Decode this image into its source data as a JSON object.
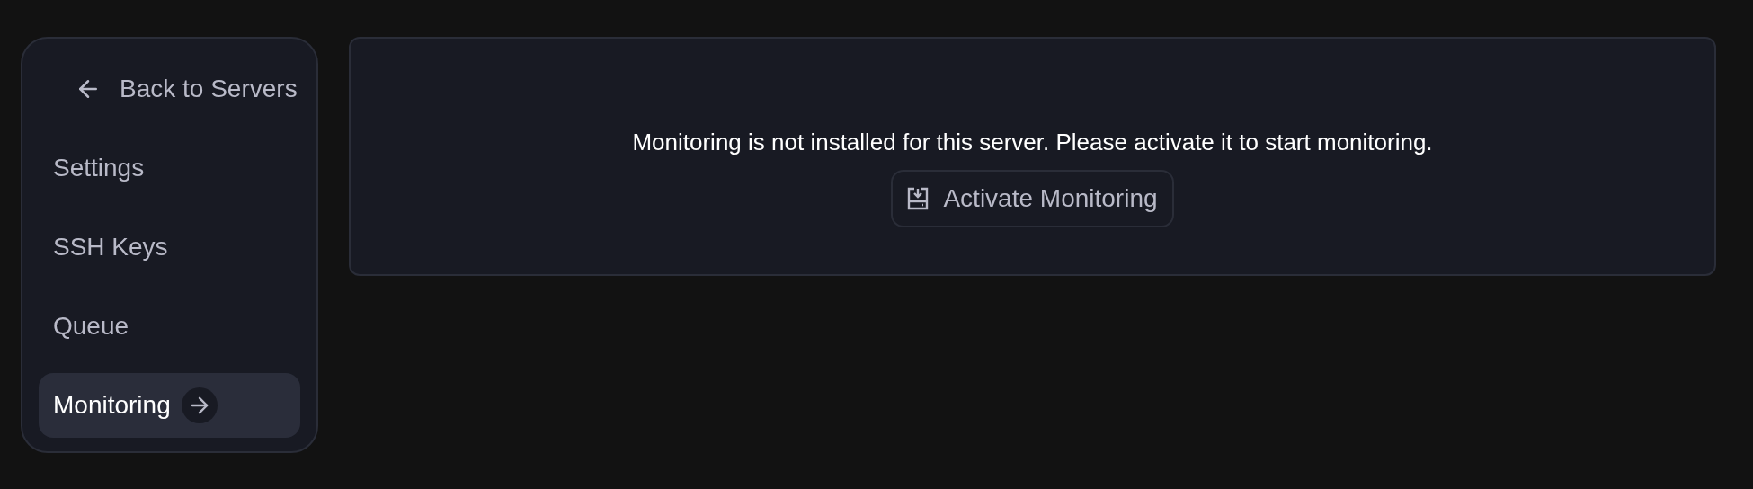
{
  "sidebar": {
    "back_link": "Back to Servers",
    "items": [
      {
        "label": "Settings",
        "selected": false
      },
      {
        "label": "SSH Keys",
        "selected": false
      },
      {
        "label": "Queue",
        "selected": false
      },
      {
        "label": "Monitoring",
        "selected": true
      }
    ]
  },
  "main": {
    "message": "Monitoring is not installed for this server. Please activate it to start monitoring.",
    "button": "Activate Monitoring"
  }
}
